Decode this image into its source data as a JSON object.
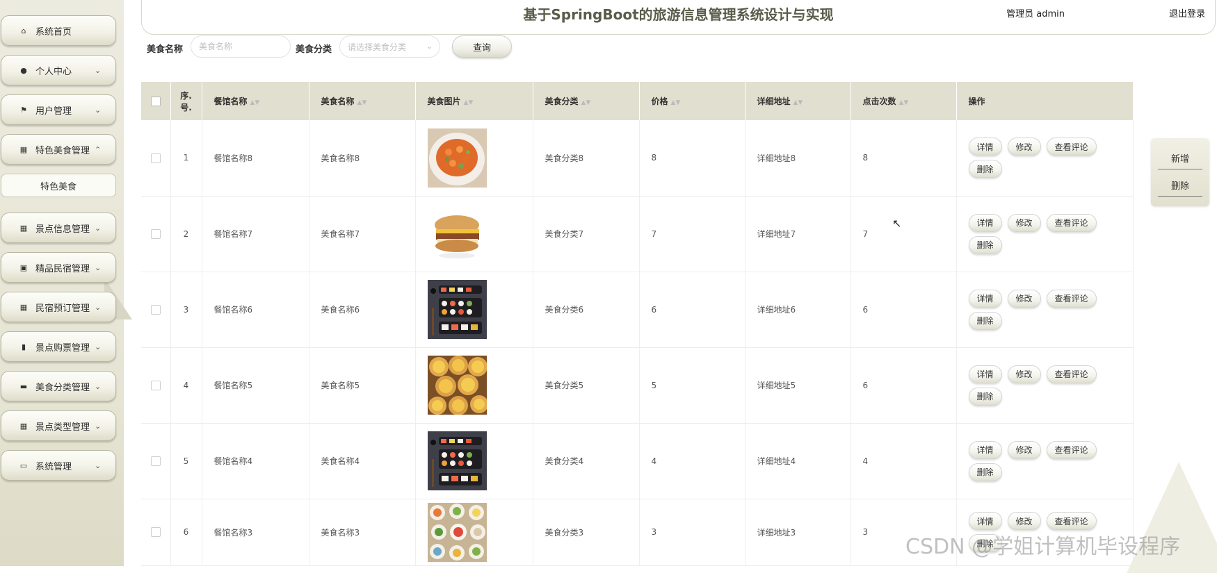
{
  "header": {
    "title": "基于SpringBoot的旅游信息管理系统设计与实现",
    "admin_text": "管理员 admin",
    "logout": "退出登录"
  },
  "sidebar": {
    "items": [
      {
        "label": "系统首页",
        "icon": "home-icon",
        "glyph": "⌂"
      },
      {
        "label": "个人中心",
        "icon": "person-icon",
        "glyph": "●"
      },
      {
        "label": "用户管理",
        "icon": "flag-icon",
        "glyph": "⚑"
      },
      {
        "label": "特色美食管理",
        "icon": "grid-icon",
        "glyph": "▦"
      },
      {
        "label": "景点信息管理",
        "icon": "grid-icon",
        "glyph": "▦"
      },
      {
        "label": "精品民宿管理",
        "icon": "clipboard-icon",
        "glyph": "▣"
      },
      {
        "label": "民宿预订管理",
        "icon": "grid-icon",
        "glyph": "▦"
      },
      {
        "label": "景点购票管理",
        "icon": "bar-chart-icon",
        "glyph": "▮"
      },
      {
        "label": "美食分类管理",
        "icon": "briefcase-icon",
        "glyph": "▬"
      },
      {
        "label": "景点类型管理",
        "icon": "grid-icon",
        "glyph": "▦"
      },
      {
        "label": "系统管理",
        "icon": "monitor-icon",
        "glyph": "▭"
      }
    ],
    "sub_item": "特色美食"
  },
  "search": {
    "name_label": "美食名称",
    "name_placeholder": "美食名称",
    "category_label": "美食分类",
    "category_placeholder": "请选择美食分类",
    "query_button": "查询"
  },
  "table": {
    "headers": [
      "序号.",
      "餐馆名称",
      "美食名称",
      "美食图片",
      "美食分类",
      "价格",
      "详细地址",
      "点击次数",
      "操作"
    ],
    "index_header_lines": [
      "序.",
      "号."
    ],
    "rows": [
      {
        "index": "1",
        "restaurant": "餐馆名称8",
        "food": "美食名称8",
        "image": "carrot-salad",
        "category": "美食分类8",
        "price": "8",
        "address": "详细地址8",
        "clicks": "8"
      },
      {
        "index": "2",
        "restaurant": "餐馆名称7",
        "food": "美食名称7",
        "image": "muffin-sandwich",
        "category": "美食分类7",
        "price": "7",
        "address": "详细地址7",
        "clicks": "7"
      },
      {
        "index": "3",
        "restaurant": "餐馆名称6",
        "food": "美食名称6",
        "image": "sushi-box",
        "category": "美食分类6",
        "price": "6",
        "address": "详细地址6",
        "clicks": "6"
      },
      {
        "index": "4",
        "restaurant": "餐馆名称5",
        "food": "美食名称5",
        "image": "egg-tarts",
        "category": "美食分类5",
        "price": "5",
        "address": "详细地址5",
        "clicks": "6"
      },
      {
        "index": "5",
        "restaurant": "餐馆名称4",
        "food": "美食名称4",
        "image": "sushi-box",
        "category": "美食分类4",
        "price": "4",
        "address": "详细地址4",
        "clicks": "4"
      },
      {
        "index": "6",
        "restaurant": "餐馆名称3",
        "food": "美食名称3",
        "image": "dim-sum",
        "category": "美食分类3",
        "price": "3",
        "address": "详细地址3",
        "clicks": "3"
      }
    ],
    "actions": [
      "详情",
      "修改",
      "查看评论",
      "删除"
    ]
  },
  "side_actions": {
    "add": "新增",
    "delete": "删除"
  },
  "watermark": "CSDN @学姐计算机毕设程序"
}
